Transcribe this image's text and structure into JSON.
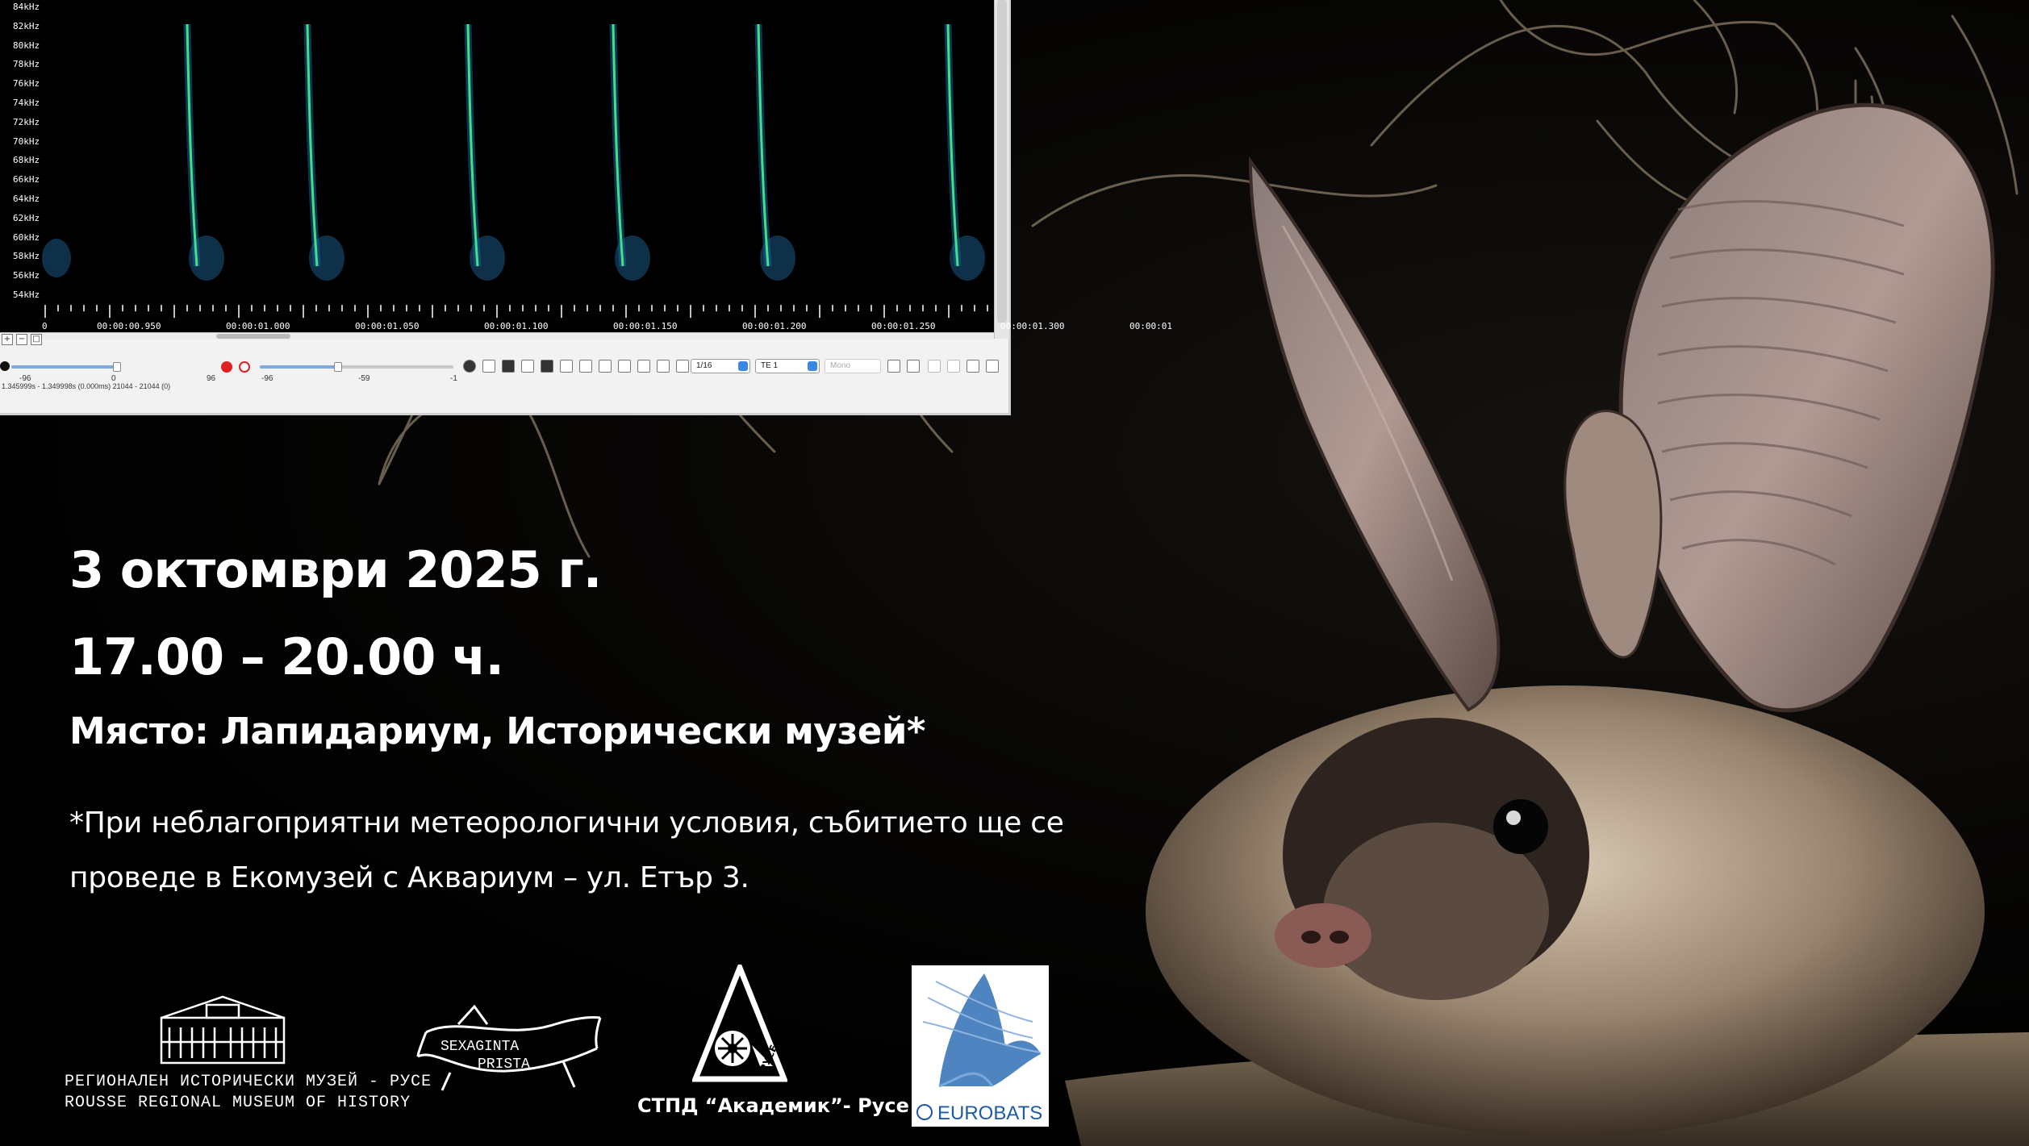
{
  "spectrogram": {
    "freq_labels": [
      "84kHz",
      "82kHz",
      "80kHz",
      "78kHz",
      "76kHz",
      "74kHz",
      "72kHz",
      "70kHz",
      "68kHz",
      "66kHz",
      "64kHz",
      "62kHz",
      "60kHz",
      "58kHz",
      "56kHz",
      "54kHz"
    ],
    "time_labels": [
      "00:00:00.950",
      "00:00:01.000",
      "00:00:01.050",
      "00:00:01.100",
      "00:00:01.150",
      "00:00:01.200",
      "00:00:01.250",
      "00:00:01.300",
      "00:00:01"
    ],
    "left_axis_label": "0",
    "slider_values": [
      "-96",
      "0",
      "96",
      "-96",
      "-59",
      "-1"
    ],
    "rate_combo": "1/16",
    "te_combo": "TE  1",
    "mono_combo": "Mono",
    "status_text": "1.345999s - 1.349998s (0.000ms) 21044 - 21044 (0)",
    "colors": {
      "call_bright": "#3fe08a",
      "call_dim": "#1b5f8f"
    }
  },
  "event": {
    "date": "3 октомври 2025 г.",
    "time": "17.00 – 20.00 ч.",
    "place": "Място: Лапидариум, Исторически музей*",
    "note_line1": "*При неблагоприятни метеорологични условия, събитието ще се",
    "note_line2": "проведе в Екомузей с Аквариум – ул. Етър 3."
  },
  "logos": {
    "museum_bg": "РЕГИОНАЛЕН ИСТОРИЧЕСКИ МУЗЕЙ - РУСЕ",
    "museum_en": "ROUSSE REGIONAL MUSEUM OF HISTORY",
    "sexaginta_text": "SEXAGINTA PRISTA",
    "stpd_caption": "СТПД “Академик”- Русе",
    "stpd_mark": "РУСЕ",
    "eurobats_text": "EUROBATS"
  }
}
